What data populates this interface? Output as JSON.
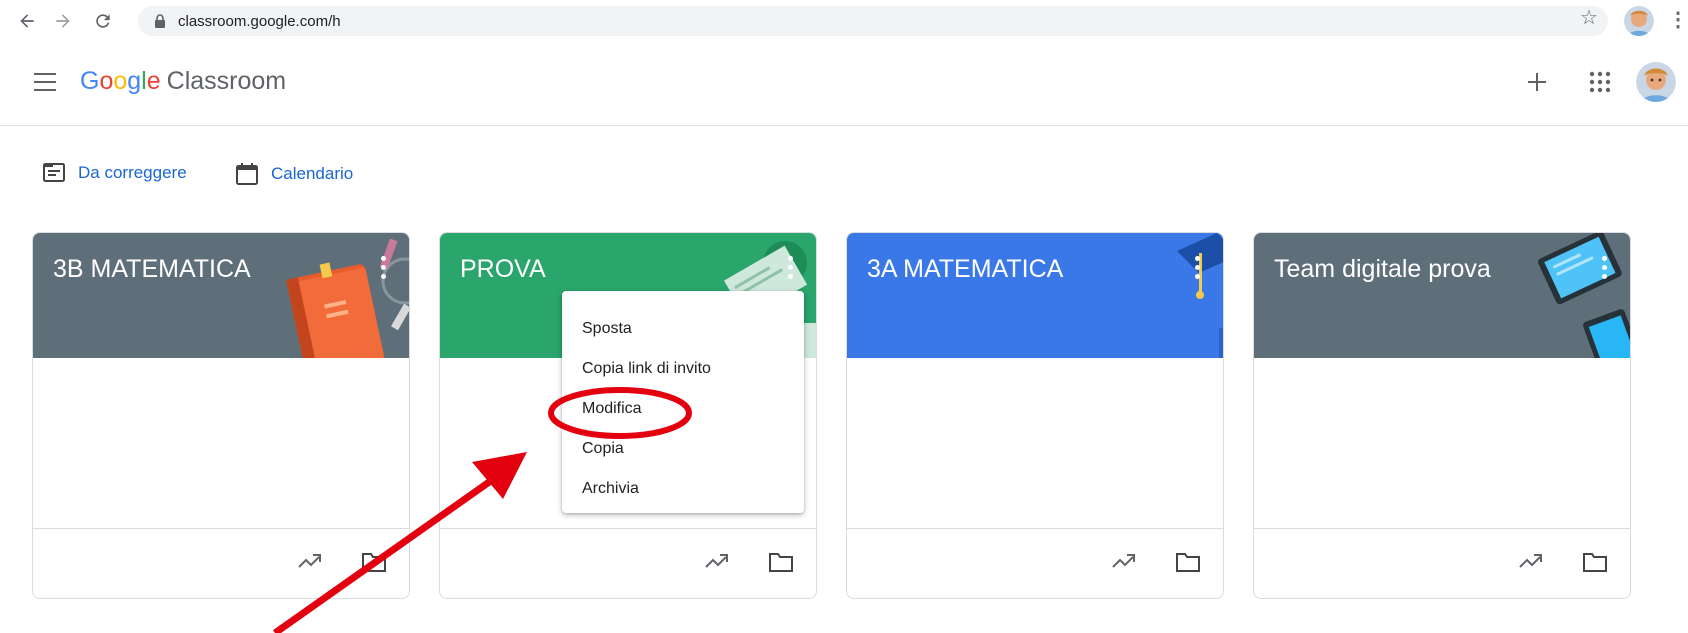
{
  "browser": {
    "url": "classroom.google.com/h"
  },
  "header": {
    "logo_google": [
      "G",
      "o",
      "o",
      "g",
      "l",
      "e"
    ],
    "logo_product": "Classroom"
  },
  "shortcuts": [
    {
      "label": "Da correggere",
      "icon": "assignment-icon"
    },
    {
      "label": "Calendario",
      "icon": "calendar-icon"
    }
  ],
  "classes": [
    {
      "title": "3B MATEMATICA",
      "color": "#5f6f7a"
    },
    {
      "title": "PROVA",
      "color": "#2aa56b"
    },
    {
      "title": "3A MATEMATICA",
      "color": "#3b78e7"
    },
    {
      "title": "Team digitale prova",
      "color": "#5f6f7a"
    }
  ],
  "context_menu": {
    "items": [
      "Sposta",
      "Copia link di invito",
      "Modifica",
      "Copia",
      "Archivia"
    ],
    "highlighted": "Modifica"
  },
  "colors": {
    "link_blue": "#1967d2",
    "annotation_red": "#e3000f"
  }
}
